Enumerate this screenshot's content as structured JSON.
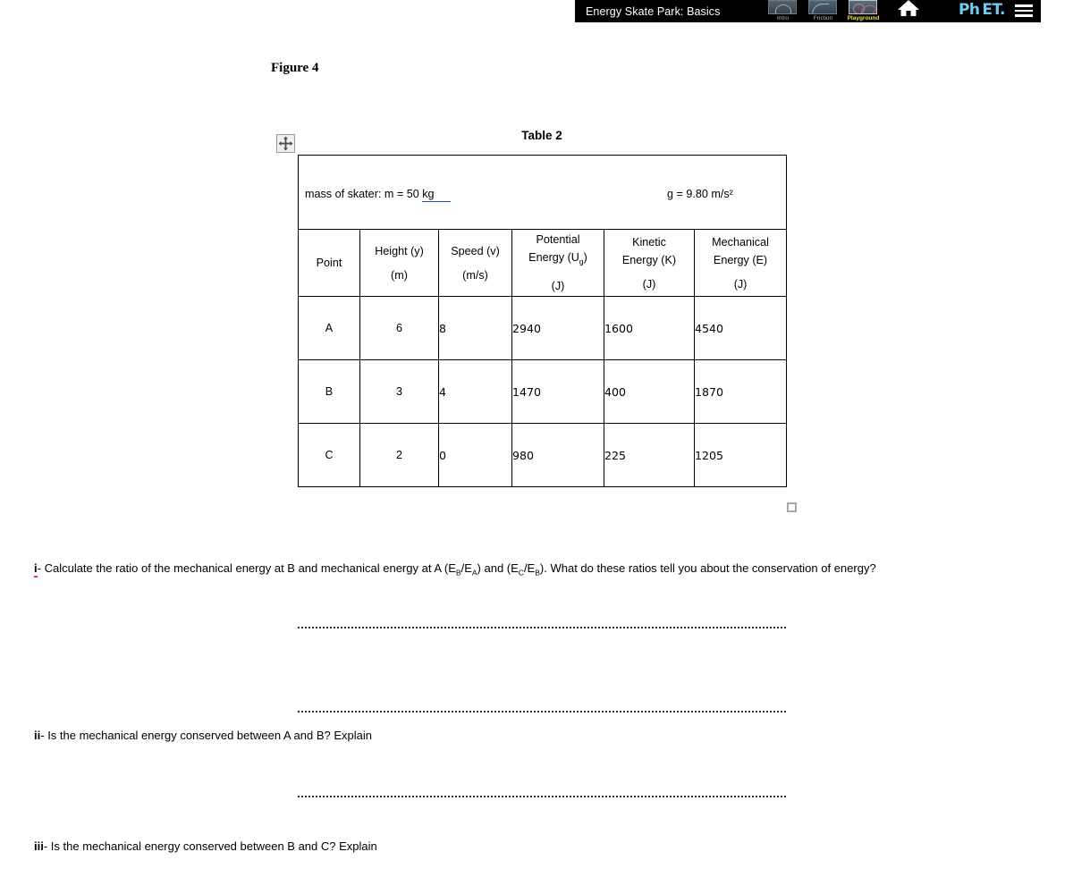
{
  "phet_nav": {
    "sim_title": "Energy Skate Park: Basics",
    "tabs": [
      {
        "label": "Intro",
        "selected": false
      },
      {
        "label": "Friction",
        "selected": false
      },
      {
        "label": "Playground",
        "selected": true
      }
    ],
    "home_icon": "home-icon",
    "logo_part1": "Ph",
    "logo_part2": "ET.",
    "menu_icon": "hamburger-menu-icon",
    "selected_tab_color": "#f2e33a",
    "logo_color": "#6fcbf0",
    "logo_accent_color": "#f5d623"
  },
  "document": {
    "figure_caption": "Figure 4",
    "table_title": "Table 2",
    "move_handle_icon": "move-handle-icon",
    "resize_handle_icon": "resize-handle-icon"
  },
  "table": {
    "meta": {
      "mass_prefix": "mass of skater: m = 50 ",
      "mass_unit": "kg",
      "gravity": "g = 9.80 m/s²",
      "spellcheck_color": "#2a4fd6"
    },
    "headers": {
      "point": "Point",
      "height_name": "Height (y)",
      "height_unit": "(m)",
      "speed_name": "Speed (v)",
      "speed_unit": "(m/s)",
      "pe_line1": "Potential",
      "pe_line2_a": "Energy (U",
      "pe_line2_sub": "g",
      "pe_line2_b": ")",
      "pe_unit": "(J)",
      "ke_line1": "Kinetic",
      "ke_line2": "Energy (K)",
      "ke_unit": "(J)",
      "me_line1": "Mechanical",
      "me_line2": "Energy (E)",
      "me_unit": "(J)"
    },
    "rows": [
      {
        "point": "A",
        "height": "6",
        "speed": "8",
        "pe": "2940",
        "ke": "1600",
        "me": "4540"
      },
      {
        "point": "B",
        "height": "3",
        "speed": "4",
        "pe": "1470",
        "ke": "400",
        "me": "1870"
      },
      {
        "point": "C",
        "height": "2",
        "speed": "0",
        "pe": "980",
        "ke": "225",
        "me": "1205"
      }
    ]
  },
  "questions": [
    {
      "marker": "i",
      "marker_suffix": "- ",
      "misspelled": true,
      "text_a": "Calculate the ratio of the mechanical energy at B and mechanical energy at A (E",
      "sub_a": "B",
      "text_b": "/E",
      "sub_b": "A",
      "text_c": ") and (E",
      "sub_c": "C",
      "text_d": "/E",
      "sub_d": "B",
      "text_e": "). What do these ratios tell you about the conservation of energy?"
    },
    {
      "marker": "ii",
      "marker_suffix": "- ",
      "misspelled": false,
      "text": "Is the mechanical energy conserved between A and B? Explain"
    },
    {
      "marker": "iii",
      "marker_suffix": "- ",
      "misspelled": false,
      "text": "Is the mechanical energy conserved between B and C? Explain"
    }
  ]
}
